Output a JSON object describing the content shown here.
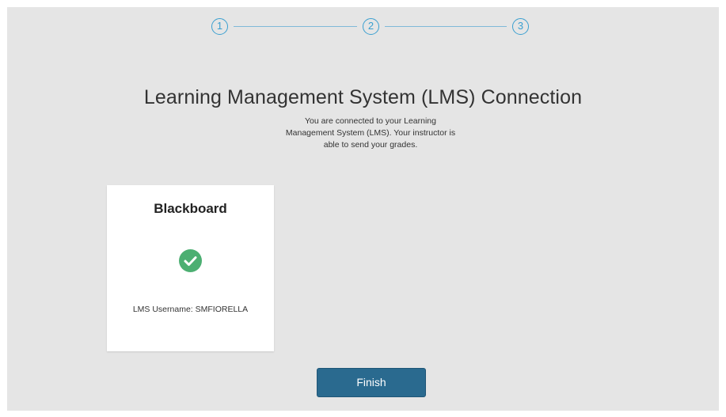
{
  "stepper": {
    "steps": [
      {
        "label": "1"
      },
      {
        "label": "2"
      },
      {
        "label": "3"
      }
    ]
  },
  "page": {
    "title": "Learning Management System (LMS) Connection",
    "subtitle": "You are connected to your Learning Management System (LMS). Your instructor is able to send your grades."
  },
  "card": {
    "title": "Blackboard",
    "status_icon": "check-circle-icon",
    "username": "LMS Username: SMFIORELLA"
  },
  "actions": {
    "finish_label": "Finish"
  },
  "colors": {
    "background": "#e5e5e5",
    "accent_blue": "#3a9fd0",
    "success_green": "#4caf72",
    "button": "#2a6a8f"
  }
}
